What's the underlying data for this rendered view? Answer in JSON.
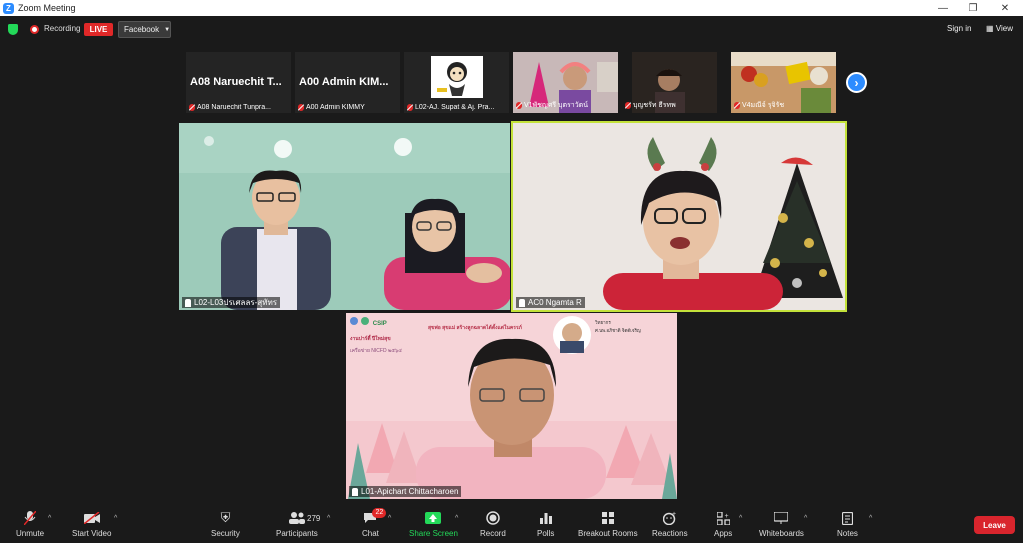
{
  "window": {
    "title": "Zoom Meeting",
    "controls": [
      "—",
      "❐",
      "✕"
    ]
  },
  "topbar": {
    "recording": "Recording",
    "live": "LIVE",
    "platform": "Facebook",
    "signin": "Sign in",
    "view": "View"
  },
  "strip": [
    {
      "big": "A08  Naruechit T...",
      "caption": "A08 Naruechit Tunpra..."
    },
    {
      "big": "A00  Admin  KIM...",
      "caption": "A00 Admin KIMMY"
    },
    {
      "big": "",
      "caption": "L02-AJ. Supat & Aj. Pra..."
    },
    {
      "big": "",
      "caption": "V1พัชญศรี บุตราวัตน์"
    },
    {
      "big": "",
      "caption": "บุญชรัท ธีรทพ"
    },
    {
      "big": "",
      "caption": "V4มณีจ์ รุจิรัช"
    }
  ],
  "tiles": {
    "left": "L02-L03ปรเศลลร-สุทัทร",
    "right": "AC0 Ngamta R",
    "center": "L01-Apichart Chittacharoen"
  },
  "slide": {
    "brand": "CSIP",
    "headline": "สุขพ่อ สุขแม่ สร้างลูกฉลาดได้ตั้งแต่ในครรภ์",
    "subtitle": "งานปาร์ตี้ ปีใหม่สุข",
    "network": "เครือข่าย NICFD ๒๕๖๔",
    "speaker_title": "วิทยากร",
    "speaker_name": "ศ.นพ.อภิชาติ จิตต์เจริญ"
  },
  "toolbar": {
    "unmute": "Unmute",
    "start_video": "Start Video",
    "security": "Security",
    "participants": "Participants",
    "participants_count": "279",
    "chat": "Chat",
    "chat_badge": "22",
    "share": "Share Screen",
    "record": "Record",
    "polls": "Polls",
    "breakout": "Breakout Rooms",
    "reactions": "Reactions",
    "apps": "Apps",
    "whiteboards": "Whiteboards",
    "notes": "Notes",
    "leave": "Leave"
  }
}
